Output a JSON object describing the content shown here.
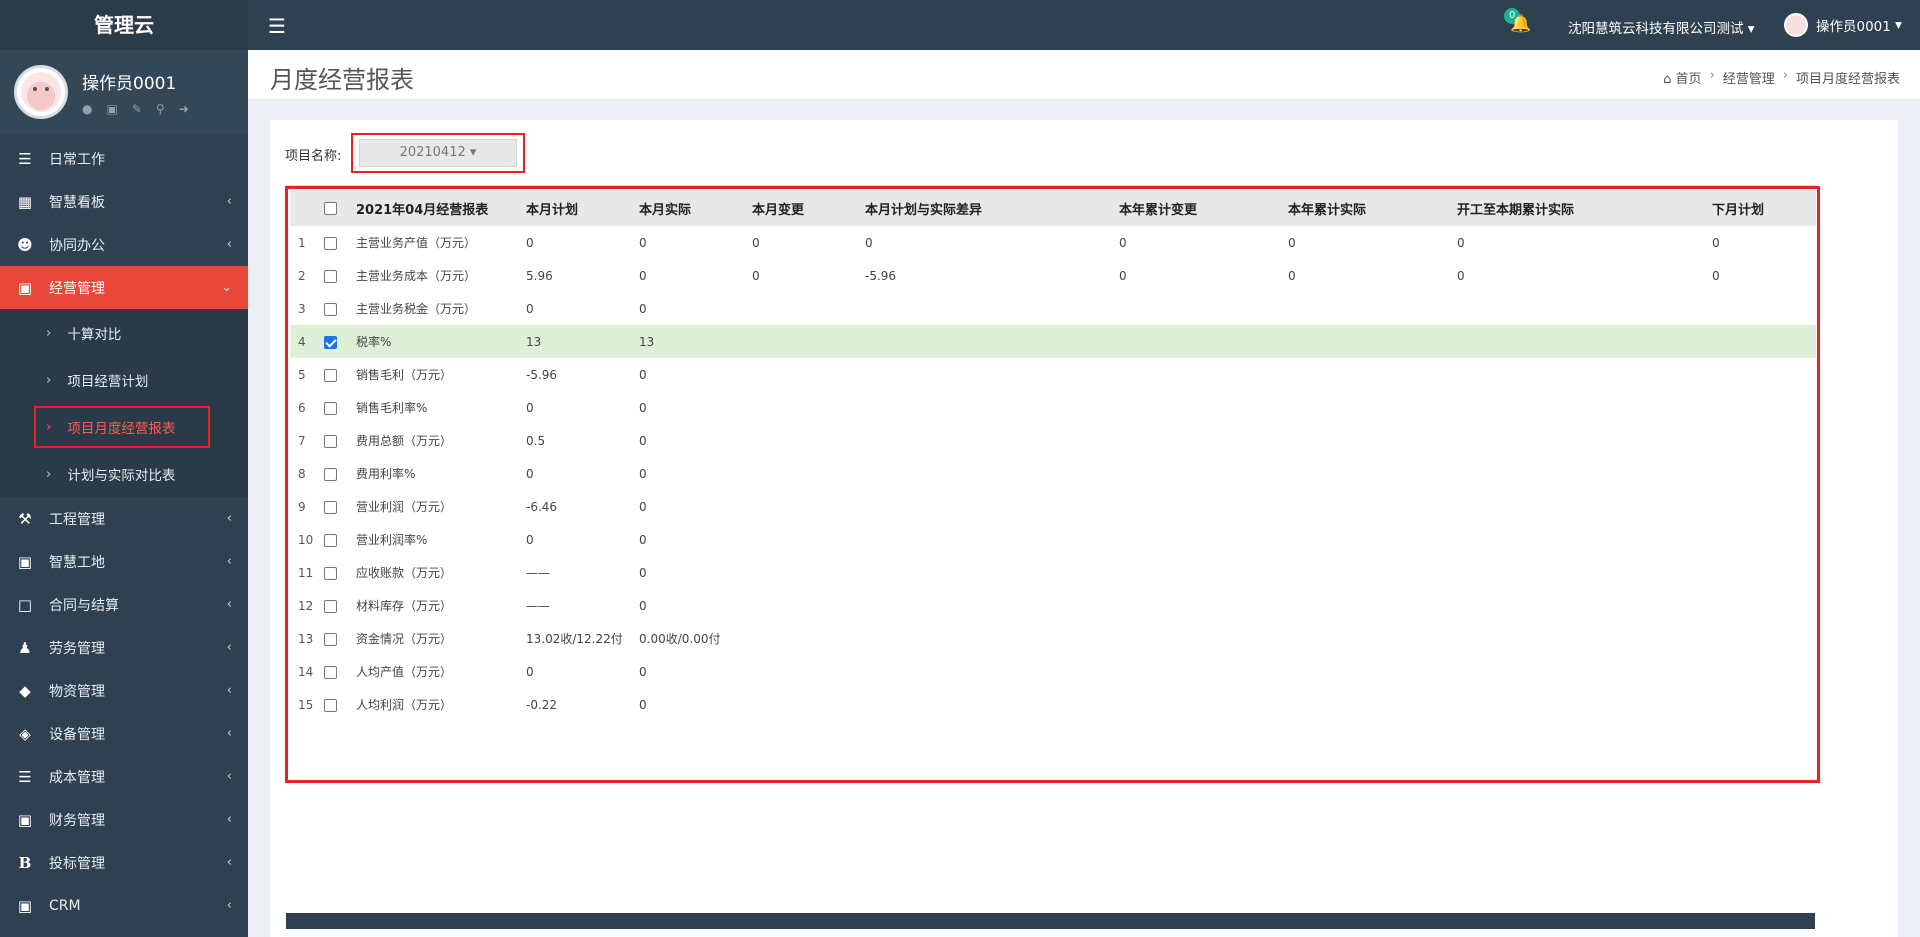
{
  "brand": "管理云",
  "profile": {
    "name": "操作员0001"
  },
  "menu": {
    "items": [
      {
        "label": "日常工作",
        "icon": "list-icon"
      },
      {
        "label": "智慧看板",
        "icon": "dashboard-icon"
      },
      {
        "label": "协同办公",
        "icon": "users-icon"
      },
      {
        "label": "经营管理",
        "icon": "desktop-icon"
      },
      {
        "label": "工程管理",
        "icon": "gavel-icon"
      },
      {
        "label": "智慧工地",
        "icon": "desktop-icon"
      },
      {
        "label": "合同与结算",
        "icon": "file-icon"
      },
      {
        "label": "劳务管理",
        "icon": "worker-icon"
      },
      {
        "label": "物资管理",
        "icon": "cube-icon"
      },
      {
        "label": "设备管理",
        "icon": "cubes-icon"
      },
      {
        "label": "成本管理",
        "icon": "list-icon"
      },
      {
        "label": "财务管理",
        "icon": "desktop-icon"
      },
      {
        "label": "投标管理",
        "icon": "bold-b-icon"
      },
      {
        "label": "CRM",
        "icon": "desktop-icon"
      }
    ],
    "sub_items": [
      {
        "label": "十算对比"
      },
      {
        "label": "项目经营计划"
      },
      {
        "label": "项目月度经营报表"
      },
      {
        "label": "计划与实际对比表"
      }
    ]
  },
  "topbar": {
    "notification_count": "0",
    "company": "沈阳慧筑云科技有限公司测试",
    "user": "操作员0001"
  },
  "page": {
    "title": "月度经营报表",
    "breadcrumb": [
      "首页",
      "经营管理",
      "项目月度经营报表"
    ]
  },
  "filter": {
    "label": "项目名称:",
    "selected": "20210412"
  },
  "table": {
    "headers": [
      "2021年04月经营报表",
      "本月计划",
      "本月实际",
      "本月变更",
      "本月计划与实际差异",
      "本年累计变更",
      "本年累计实际",
      "开工至本期累计实际",
      "下月计划"
    ],
    "rows": [
      {
        "num": "1",
        "checked": false,
        "cells": [
          "主营业务产值（万元）",
          "0",
          "0",
          "0",
          "0",
          "0",
          "0",
          "0",
          "0"
        ]
      },
      {
        "num": "2",
        "checked": false,
        "cells": [
          "主营业务成本（万元）",
          "5.96",
          "0",
          "0",
          "-5.96",
          "0",
          "0",
          "0",
          "0"
        ]
      },
      {
        "num": "3",
        "checked": false,
        "cells": [
          "主营业务税金（万元）",
          "0",
          "0",
          "",
          "",
          "",
          "",
          "",
          ""
        ]
      },
      {
        "num": "4",
        "checked": true,
        "cells": [
          "税率%",
          "13",
          "13",
          "",
          "",
          "",
          "",
          "",
          ""
        ]
      },
      {
        "num": "5",
        "checked": false,
        "cells": [
          "销售毛利（万元）",
          "-5.96",
          "0",
          "",
          "",
          "",
          "",
          "",
          ""
        ]
      },
      {
        "num": "6",
        "checked": false,
        "cells": [
          "销售毛利率%",
          "0",
          "0",
          "",
          "",
          "",
          "",
          "",
          ""
        ]
      },
      {
        "num": "7",
        "checked": false,
        "cells": [
          "费用总额（万元）",
          "0.5",
          "0",
          "",
          "",
          "",
          "",
          "",
          ""
        ]
      },
      {
        "num": "8",
        "checked": false,
        "cells": [
          "费用利率%",
          "0",
          "0",
          "",
          "",
          "",
          "",
          "",
          ""
        ]
      },
      {
        "num": "9",
        "checked": false,
        "cells": [
          "营业利润（万元）",
          "-6.46",
          "0",
          "",
          "",
          "",
          "",
          "",
          ""
        ]
      },
      {
        "num": "10",
        "checked": false,
        "cells": [
          "营业利润率%",
          "0",
          "0",
          "",
          "",
          "",
          "",
          "",
          ""
        ]
      },
      {
        "num": "11",
        "checked": false,
        "cells": [
          "应收账款（万元）",
          "——",
          "0",
          "",
          "",
          "",
          "",
          "",
          ""
        ]
      },
      {
        "num": "12",
        "checked": false,
        "cells": [
          "材料库存（万元）",
          "——",
          "0",
          "",
          "",
          "",
          "",
          "",
          ""
        ]
      },
      {
        "num": "13",
        "checked": false,
        "cells": [
          "资金情况（万元）",
          "13.02收/12.22付",
          "0.00收/0.00付",
          "",
          "",
          "",
          "",
          "",
          ""
        ]
      },
      {
        "num": "14",
        "checked": false,
        "cells": [
          "人均产值（万元）",
          "0",
          "0",
          "",
          "",
          "",
          "",
          "",
          ""
        ]
      },
      {
        "num": "15",
        "checked": false,
        "cells": [
          "人均利润（万元）",
          "-0.22",
          "0",
          "",
          "",
          "",
          "",
          "",
          ""
        ]
      }
    ]
  }
}
